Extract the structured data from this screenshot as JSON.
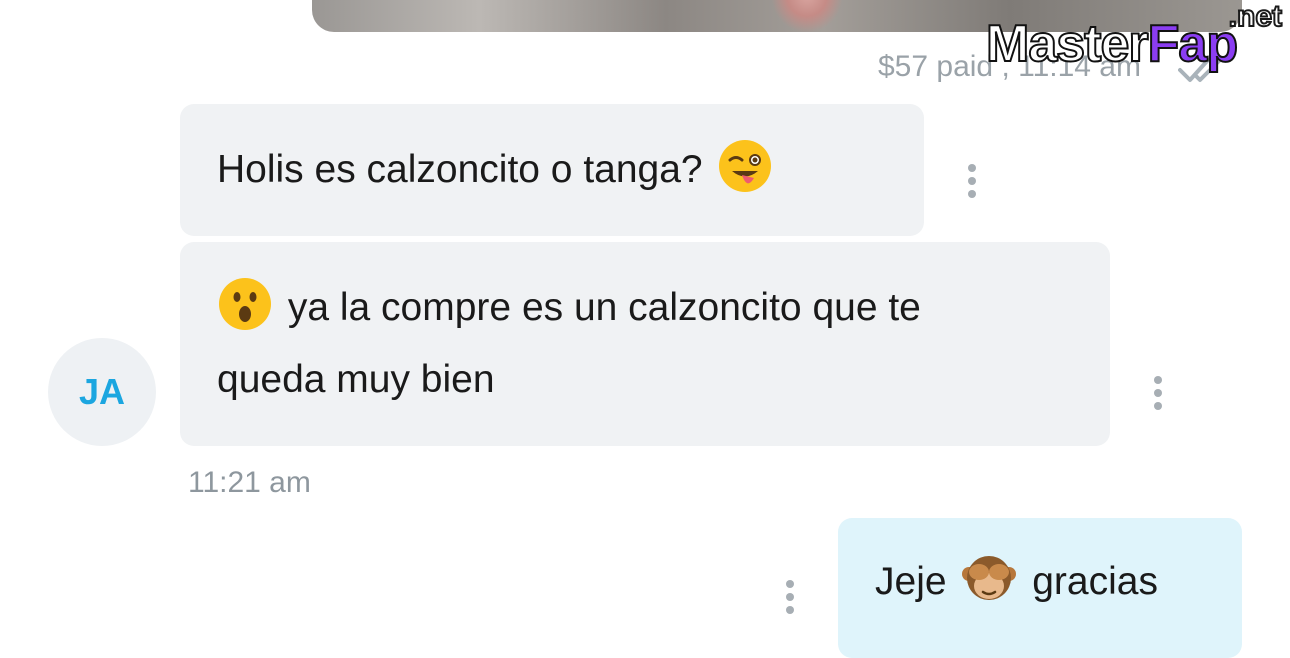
{
  "watermark": {
    "brand_part1": "Master",
    "brand_part2": "Fap",
    "tld": ".net"
  },
  "media_message": {
    "paid_meta": "$57 paid , 11:14 am",
    "status_icon": "double-check-icon"
  },
  "messages": [
    {
      "direction": "incoming",
      "text": "Holis es calzoncito o tanga?",
      "emoji": "winking-face-with-tongue"
    },
    {
      "direction": "incoming",
      "emoji": "face-with-open-mouth",
      "text_line1": "ya la compre es un calzoncito que te",
      "text_line2": "queda muy bien"
    },
    {
      "direction": "outgoing",
      "text_before": "Jeje",
      "emoji": "see-no-evil-monkey",
      "text_after": "gracias"
    }
  ],
  "sender": {
    "initials": "JA"
  },
  "incoming_timestamp": "11:21 am",
  "colors": {
    "incoming_bubble": "#f0f2f4",
    "outgoing_bubble": "#dff4fb",
    "avatar_text": "#1ba6e0",
    "meta_text": "#9aa2a8"
  }
}
